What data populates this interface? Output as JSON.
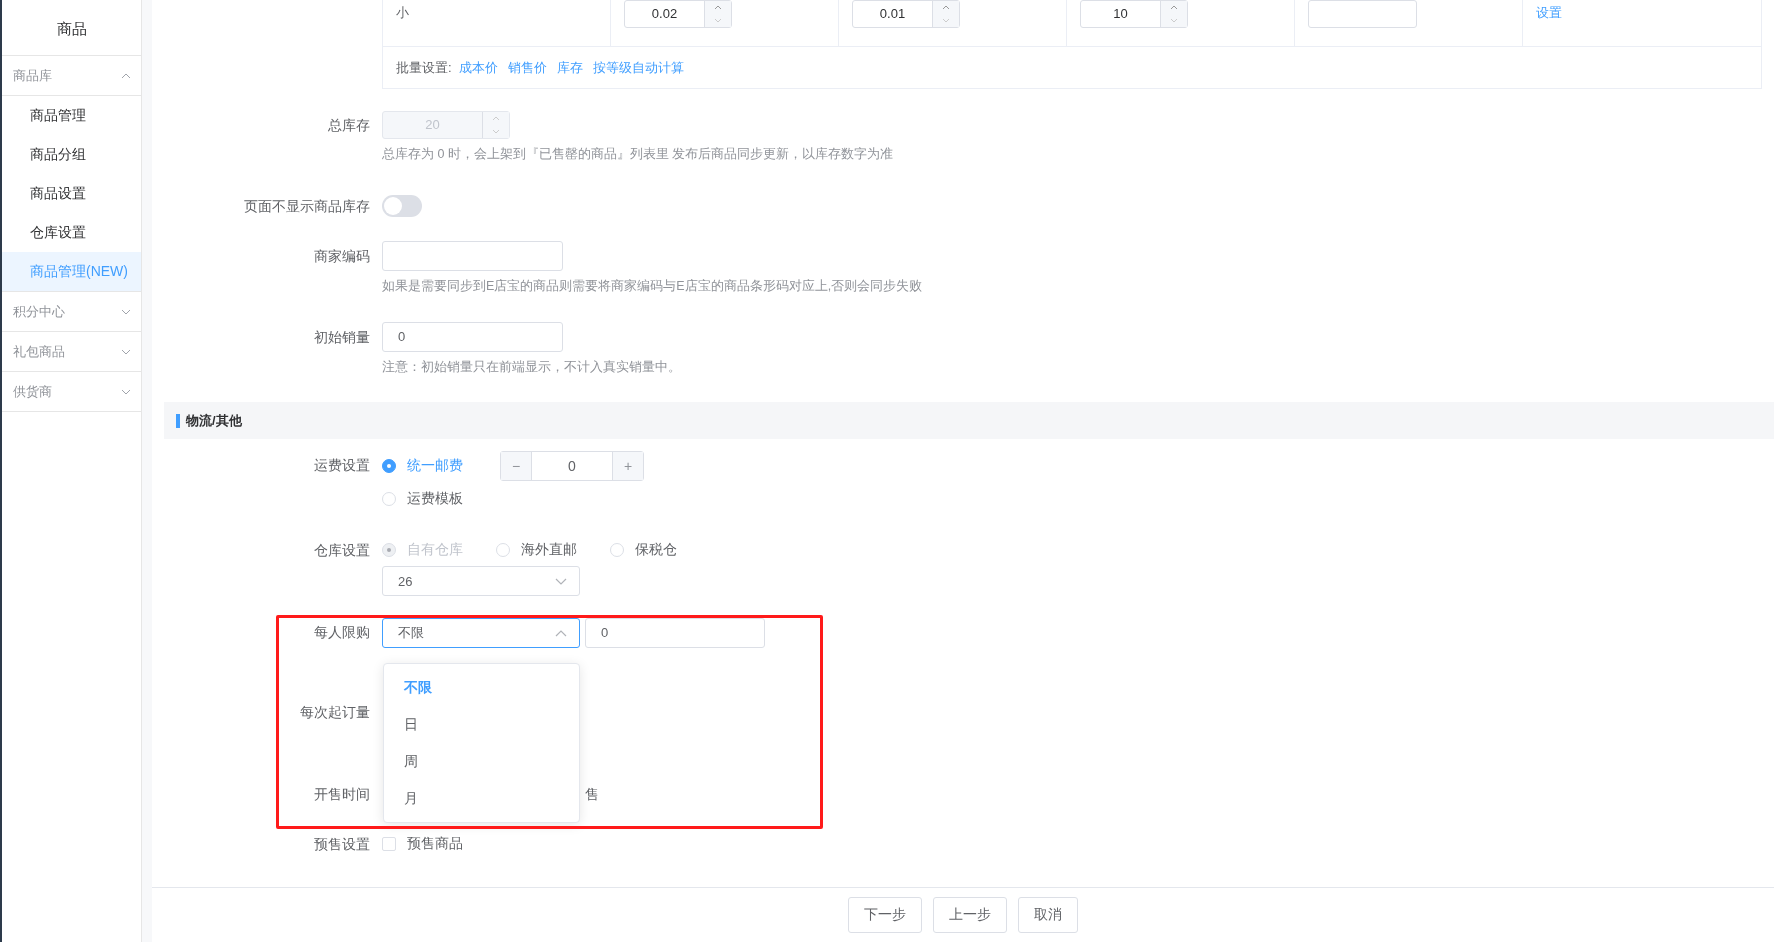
{
  "sidebar": {
    "title": "商品",
    "groups": [
      {
        "label": "商品库",
        "expanded": true,
        "children": [
          {
            "label": "商品管理",
            "selected": false
          },
          {
            "label": "商品分组",
            "selected": false
          },
          {
            "label": "商品设置",
            "selected": false
          },
          {
            "label": "仓库设置",
            "selected": false
          },
          {
            "label": "商品管理(NEW)",
            "selected": true
          }
        ]
      },
      {
        "label": "积分中心",
        "expanded": false
      },
      {
        "label": "礼包商品",
        "expanded": false
      },
      {
        "label": "供货商",
        "expanded": false
      }
    ]
  },
  "sku_table": {
    "row": {
      "name": "小",
      "steppers": [
        "0.02",
        "0.01",
        "10"
      ],
      "link": "设置"
    },
    "batch": {
      "label": "批量设置:",
      "links": [
        "成本价",
        "销售价",
        "库存",
        "按等级自动计算"
      ]
    }
  },
  "fields": [
    {
      "kind": "stepper",
      "label": "总库存",
      "value": "20",
      "disabled": true,
      "hint": "总库存为 0 时，会上架到『已售罄的商品』列表里 发布后商品同步更新，以库存数字为准"
    },
    {
      "kind": "toggle",
      "label": "页面不显示商品库存",
      "on": false
    },
    {
      "kind": "input",
      "label": "商家编码",
      "hint": "如果是需要同步到E店宝的商品则需要将商家编码与E店宝的商品条形码对应上,否则会同步失败"
    },
    {
      "kind": "input",
      "label": "初始销量",
      "value": "0",
      "hint": "注意：初始销量只在前端显示，不计入真实销量中。"
    }
  ],
  "section": {
    "title": "物流/其他"
  },
  "shipping": {
    "label": "运费设置",
    "options": [
      {
        "label": "统一邮费",
        "selected": true
      },
      {
        "label": "运费模板",
        "selected": false
      }
    ],
    "fee": "0",
    "minus": "−",
    "plus": "+"
  },
  "warehouse": {
    "label": "仓库设置",
    "options": [
      {
        "label": "自有仓库",
        "selected": true,
        "disabled": true
      },
      {
        "label": "海外直邮",
        "selected": false,
        "disabled": false
      },
      {
        "label": "保税仓",
        "selected": false,
        "disabled": false
      }
    ],
    "select_value": "26"
  },
  "purchase_limit": {
    "label": "每人限购",
    "select_value": "不限",
    "expanded": true,
    "input_value": "0",
    "options": [
      {
        "label": "不限",
        "selected": true
      },
      {
        "label": "日",
        "selected": false
      },
      {
        "label": "周",
        "selected": false
      },
      {
        "label": "月",
        "selected": false
      }
    ]
  },
  "min_order": {
    "label": "每次起订量"
  },
  "sale_time": {
    "label": "开售时间",
    "visible_text": "售"
  },
  "presale": {
    "label": "预售设置",
    "option": "预售商品",
    "checked": false
  },
  "footer": {
    "buttons": [
      "下一步",
      "上一步",
      "取消"
    ]
  }
}
